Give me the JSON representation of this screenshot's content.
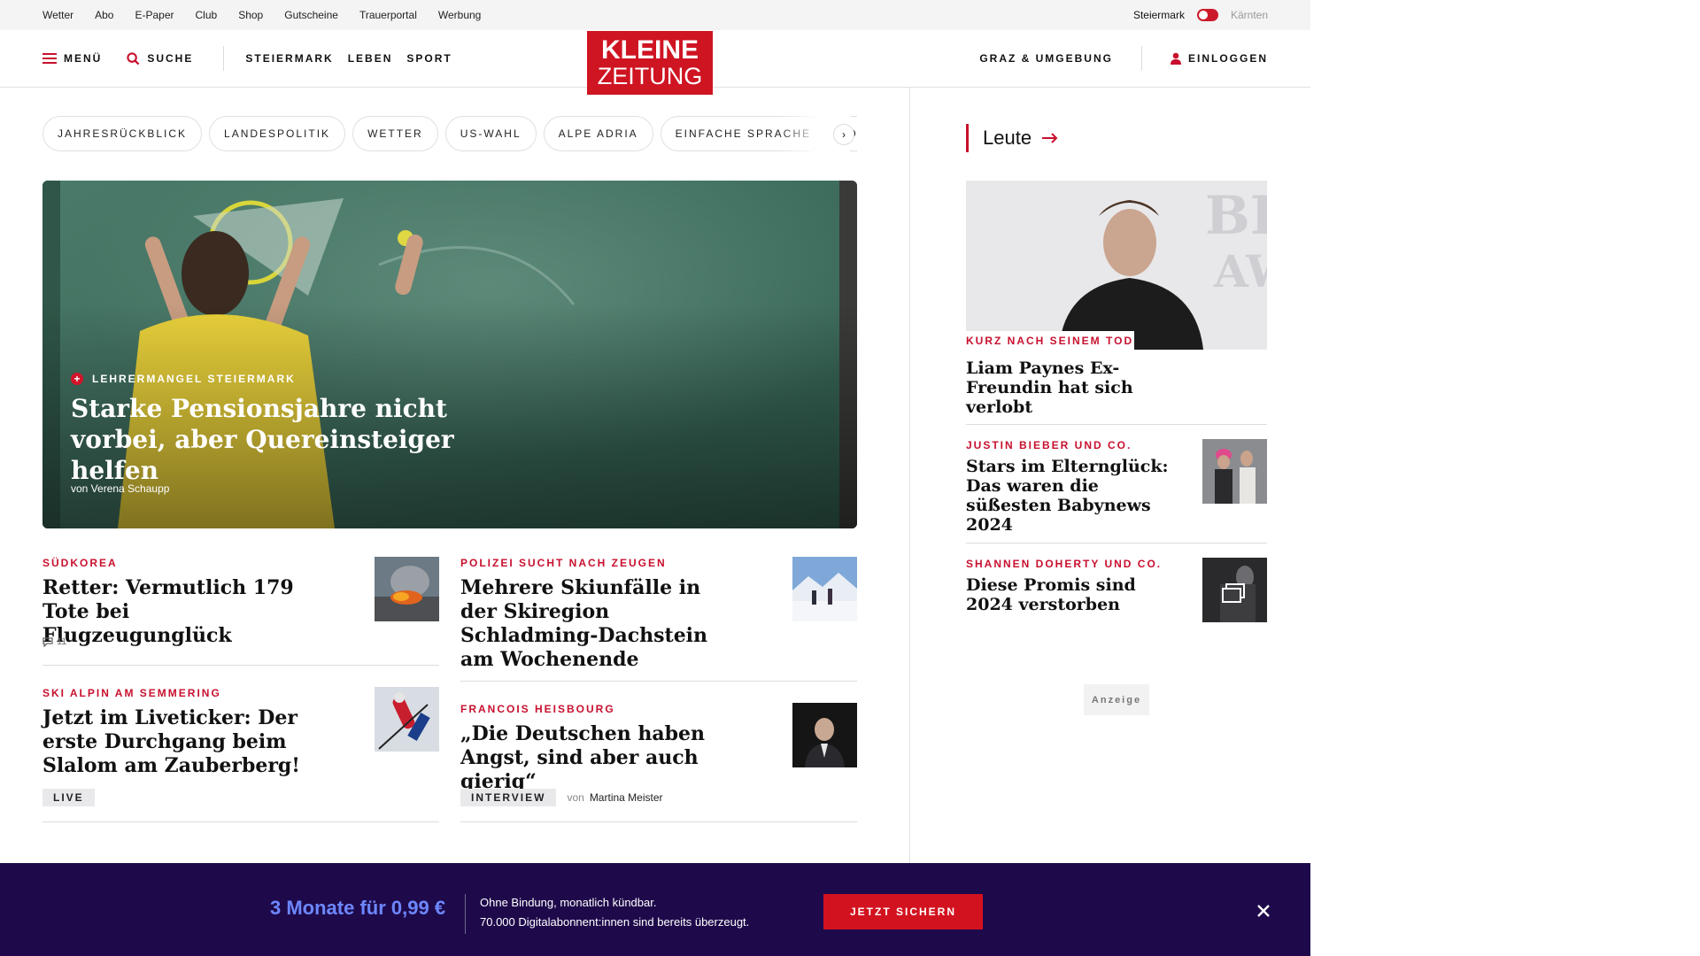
{
  "topbar": {
    "links": [
      "Wetter",
      "Abo",
      "E-Paper",
      "Club",
      "Shop",
      "Gutscheine",
      "Trauerportal",
      "Werbung"
    ],
    "region_left": "Steiermark",
    "region_right": "Kärnten"
  },
  "header": {
    "menu_label": "Menü",
    "search_label": "Suche",
    "nav": [
      "Steiermark",
      "Leben",
      "Sport"
    ],
    "logo_line1": "KLEINE",
    "logo_line2": "ZEITUNG",
    "region_link": "Graz & Umgebung",
    "login_label": "Einloggen"
  },
  "tags": [
    "Jahresrückblick",
    "Landespolitik",
    "Wetter",
    "US-Wahl",
    "Alpe Adria",
    "Einfache Sprache",
    "Do"
  ],
  "hero": {
    "kicker": "Lehrermangel Steiermark",
    "title": "Starke Pensionsjahre nicht vorbei, aber Quereinsteiger helfen",
    "author": "von Verena Schaupp"
  },
  "articles": [
    {
      "kicker": "Südkorea",
      "title": "Retter: Vermutlich 179 Tote bei Flugzeugunglück",
      "comments": "11"
    },
    {
      "kicker": "Polizei sucht nach Zeugen",
      "title": "Mehrere Skiunfälle in der Skiregion Schladming-Dachstein am Wochenende"
    },
    {
      "kicker": "Ski Alpin am Semmering",
      "title": "Jetzt im Liveticker: Der erste Durchgang beim Slalom am Zauberberg!",
      "badge": "Live"
    },
    {
      "kicker": "Francois Heisbourg",
      "title": "„Die Deutschen haben Angst, sind aber auch gierig“",
      "badge": "Interview",
      "author_prefix": "von",
      "author": "Martina Meister"
    }
  ],
  "right": {
    "section_title": "Leute",
    "items": [
      {
        "kicker": "Kurz nach seinem Tod",
        "title": "Liam Paynes Ex-Freundin hat sich verlobt"
      },
      {
        "kicker": "Justin Bieber und Co.",
        "title": "Stars im Elternglück: Das waren die süßesten Babynews 2024"
      },
      {
        "kicker": "Shannen Doherty und Co.",
        "title": "Diese Promis sind 2024 verstorben"
      }
    ],
    "ad_label": "Anzeige"
  },
  "promo": {
    "price": "3 Monate für 0,99 €",
    "line1": "Ohne Bindung, monatlich kündbar.",
    "line2": "70.000 Digitalabonnent:innen sind bereits überzeugt.",
    "cta": "Jetzt sichern"
  },
  "colors": {
    "brand_red": "#cf1422",
    "kicker_red": "#c8102e",
    "promo_bg": "#1e0a4b",
    "promo_accent": "#6d87ff"
  }
}
